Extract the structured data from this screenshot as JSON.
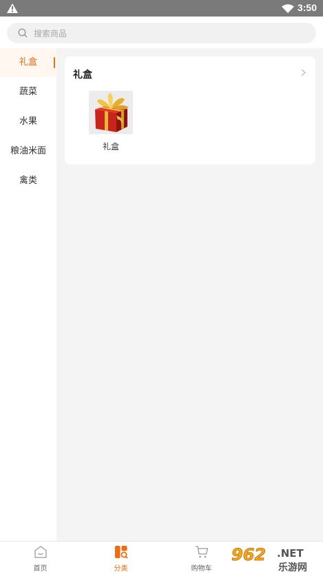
{
  "status_bar": {
    "time": "3:50"
  },
  "search": {
    "placeholder": "搜索商品"
  },
  "sidebar": {
    "items": [
      {
        "label": "礼盒",
        "active": true
      },
      {
        "label": "蔬菜"
      },
      {
        "label": "水果"
      },
      {
        "label": "粮油米面"
      },
      {
        "label": "禽类"
      }
    ]
  },
  "section": {
    "title": "礼盒",
    "products": [
      {
        "name": "礼盒"
      }
    ]
  },
  "bottom_nav": {
    "items": [
      {
        "label": "首页",
        "icon": "home-icon"
      },
      {
        "label": "分类",
        "icon": "category-icon",
        "active": true
      },
      {
        "label": "购物车",
        "icon": "cart-icon"
      }
    ]
  },
  "watermark": {
    "brand": "962",
    "suffix": ".NET",
    "subtitle": "乐游网"
  },
  "colors": {
    "accent": "#f06c0c",
    "status_bar": "#7a7a7a",
    "background": "#f4f4f4"
  }
}
